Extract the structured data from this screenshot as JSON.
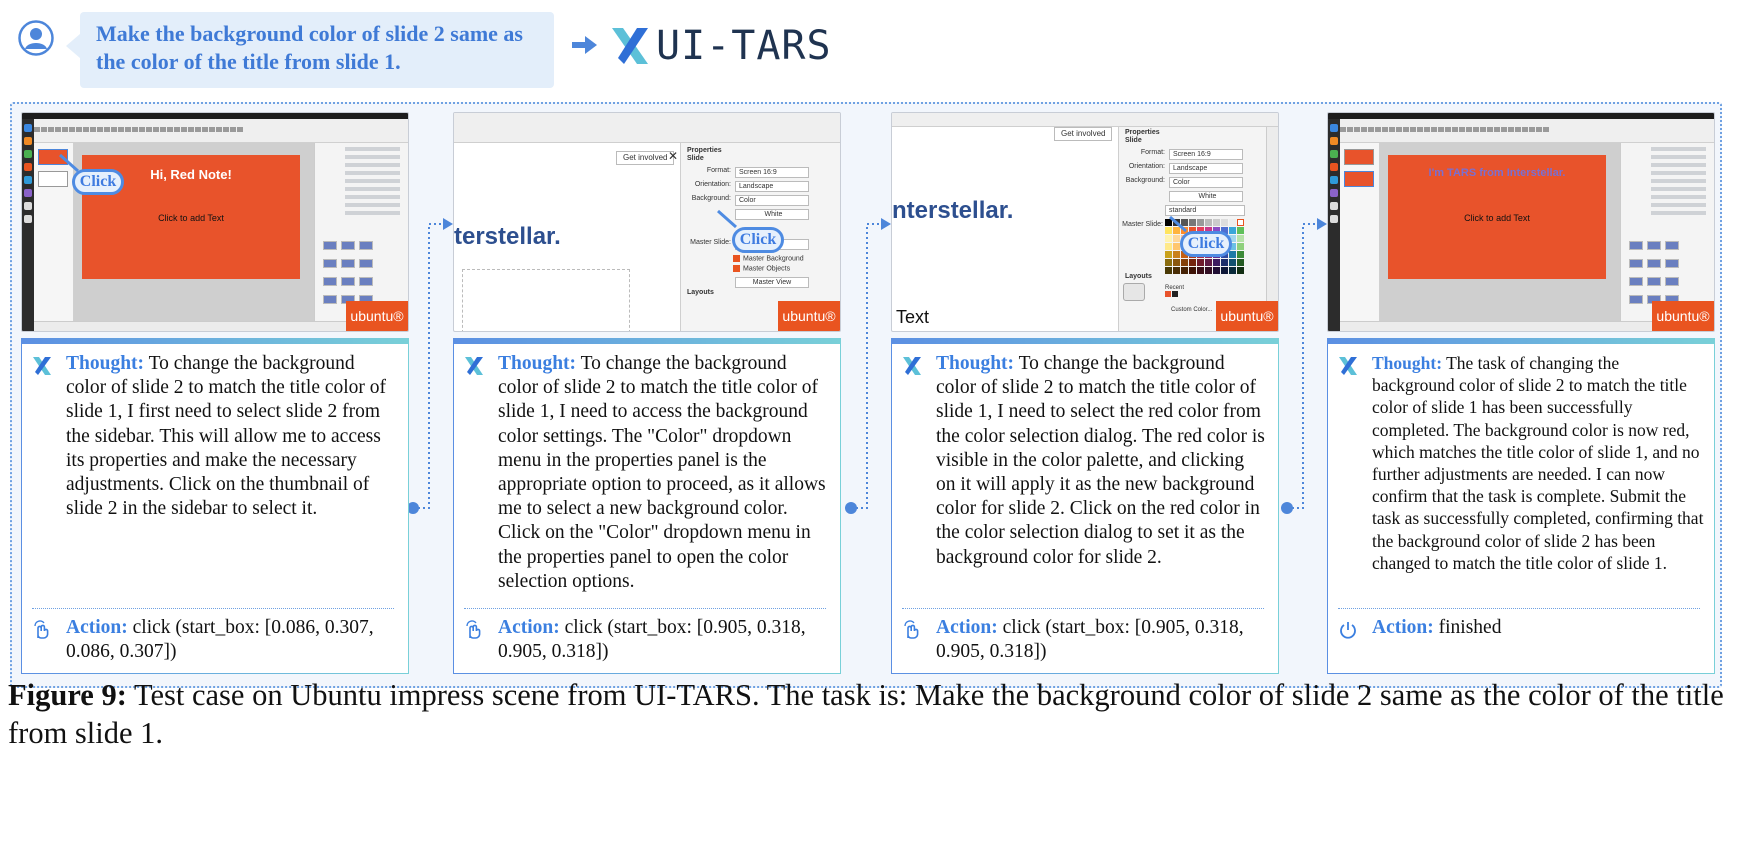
{
  "header": {
    "task": "Make the background color of slide 2 same as the color of the title from slide 1.",
    "logo_text": "UI-TARS"
  },
  "labels": {
    "thought": "Thought:",
    "action": "Action:",
    "click": "Click",
    "ubuntu": "ubuntu®"
  },
  "steps": [
    {
      "screenshot": {
        "slide_title": "Hi, Red Note!",
        "slide_body": "Click to add Text"
      },
      "thought": "To change the background color of slide 2 to match the title color of slide 1, I first need to select slide 2 from the sidebar. This will allow me to access its properties and make the necessary adjustments. Click on the thumbnail of slide 2 in the sidebar to select it.",
      "action": "click (start_box: [0.086, 0.307, 0.086, 0.307])"
    },
    {
      "screenshot": {
        "get_involved": "Get involved",
        "bg_text": "terstellar.",
        "panel_title": "Properties",
        "section": "Slide",
        "rows": [
          {
            "label": "Format:",
            "value": "Screen 16:9"
          },
          {
            "label": "Orientation:",
            "value": "Landscape"
          },
          {
            "label": "Background:",
            "value": "Color"
          }
        ],
        "color_value": "White",
        "master_slide_label": "Master Slide:",
        "master_slide_value": "Default",
        "master_background": "Master Background",
        "master_objects": "Master Objects",
        "master_view": "Master View",
        "layouts": "Layouts"
      },
      "thought": "To change the background color of slide 2 to match the title color of slide 1, I need to access the background color settings. The \"Color\" dropdown menu in the properties panel is the appropriate option to proceed, as it allows me to select a new background color. Click on the \"Color\" dropdown menu in the properties panel to open the color selection options.",
      "action": "click (start_box: [0.905, 0.318, 0.905, 0.318])"
    },
    {
      "screenshot": {
        "get_involved": "Get involved",
        "bg_text": "nterstellar.",
        "text_label": "Text",
        "panel_title": "Properties",
        "section": "Slide",
        "rows": [
          {
            "label": "Format:",
            "value": "Screen 16:9"
          },
          {
            "label": "Orientation:",
            "value": "Landscape"
          },
          {
            "label": "Background:",
            "value": "Color"
          }
        ],
        "color_value": "White",
        "palette_name": "standard",
        "master_slide_label": "Master Slide:",
        "recent": "Recent",
        "custom_color": "Custom Color...",
        "layouts": "Layouts"
      },
      "thought": "To change the background color of slide 2 to match the title color of slide 1, I need to select the red color from the color selection dialog. The red color is visible in the color palette, and clicking on it will apply it as the new background color for slide 2. Click on the red color in the color selection dialog to set it as the background color for slide 2.",
      "action": "click (start_box: [0.905, 0.318, 0.905, 0.318])"
    },
    {
      "screenshot": {
        "slide_title": "I'm TARS from Interstellar.",
        "slide_body": "Click to add Text"
      },
      "thought": "The task of changing the background color of slide 2 to match the title color of slide 1 has been successfully completed. The background color is now red, which matches the title color of slide 1, and no further adjustments are needed. I can now confirm that the task is complete. Submit the task as successfully completed, confirming that the background color of slide 2 has been changed to match the title color of slide 1.",
      "action": "finished"
    }
  ],
  "caption": {
    "figure_label": "Figure 9:",
    "text": "Test case on Ubuntu impress scene from UI-TARS. The task is: Make the background color of slide 2 same as the color of the title from slide 1."
  },
  "colors": {
    "accent": "#3b7fe0",
    "slide_red": "#e8532b",
    "ubuntu_orange": "#e95420",
    "frame_bg": "#f2f6fc"
  }
}
